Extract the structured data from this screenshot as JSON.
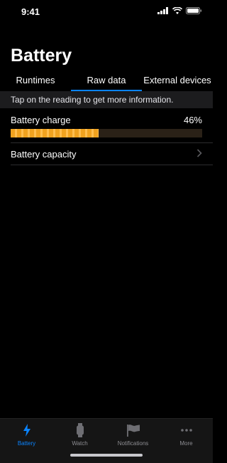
{
  "status_bar": {
    "time": "9:41"
  },
  "page": {
    "title": "Battery"
  },
  "tabs": [
    {
      "label": "Runtimes"
    },
    {
      "label": "Raw data"
    },
    {
      "label": "External devices"
    }
  ],
  "info": {
    "text": "Tap on the reading to get more information."
  },
  "battery_charge": {
    "label": "Battery charge",
    "value": "46%",
    "fraction": 0.46
  },
  "battery_capacity": {
    "label": "Battery capacity"
  },
  "tab_bar": {
    "items": [
      {
        "label": "Battery",
        "icon": "bolt-icon",
        "active": true
      },
      {
        "label": "Watch",
        "icon": "watch-icon",
        "active": false
      },
      {
        "label": "Notifications",
        "icon": "flag-icon",
        "active": false
      },
      {
        "label": "More",
        "icon": "more-icon",
        "active": false
      }
    ]
  },
  "colors": {
    "accent": "#0a84ff",
    "bar": "#f0a21f"
  }
}
